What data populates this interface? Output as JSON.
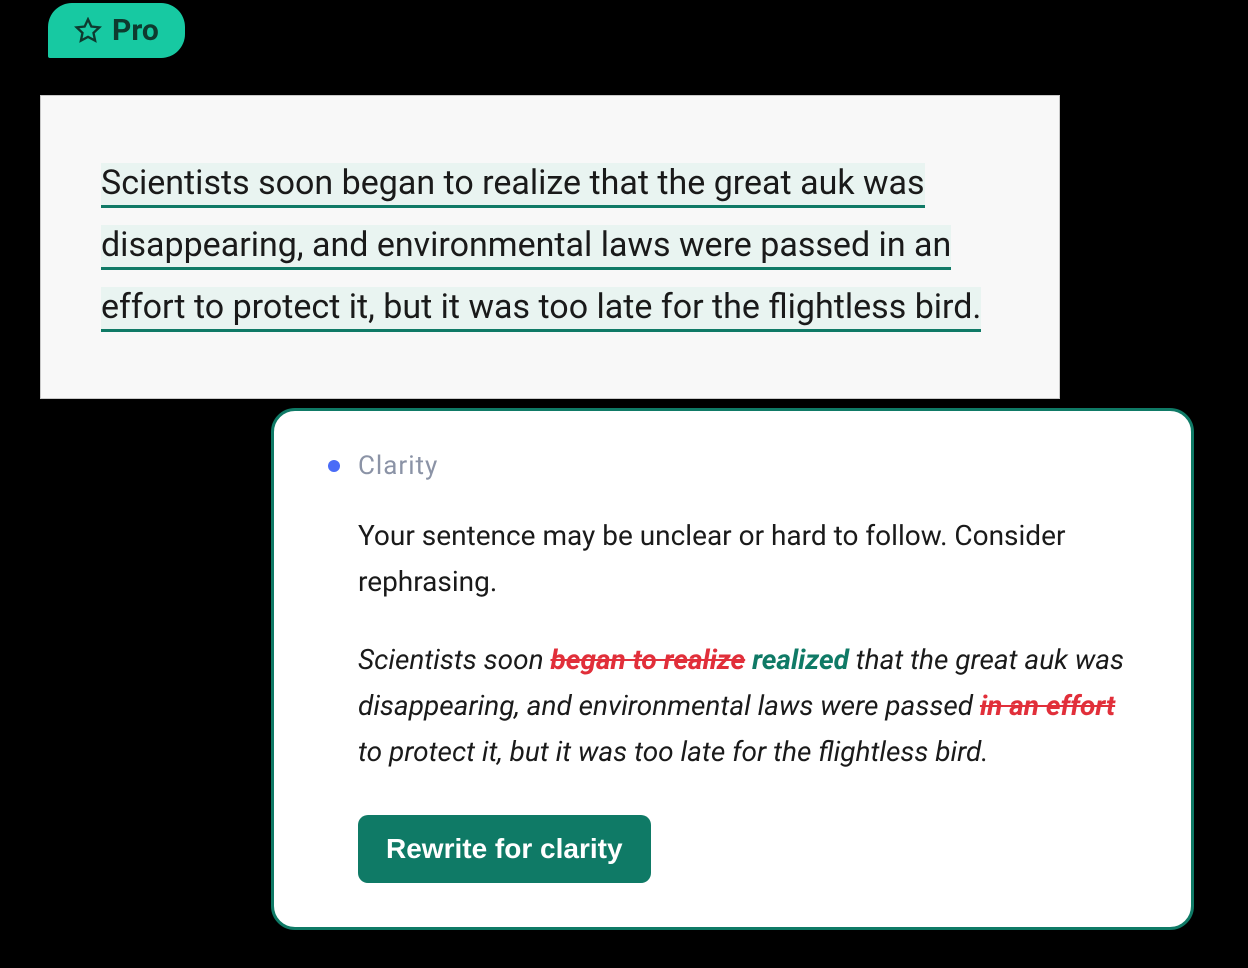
{
  "pro_badge": {
    "label": "Pro"
  },
  "editor": {
    "sentence": "Scientists soon began to realize that the great auk was disappearing, and environmental laws were passed in an effort to protect it, but it was too late for the flightless bird."
  },
  "suggestion": {
    "type_label": "Clarity",
    "description": "Your sentence may be unclear or hard to follow. Consider rephrasing.",
    "sample": {
      "pre1": "Scientists soon ",
      "strike1": "began to realize",
      "insert1": "realized",
      "mid1": " that the great auk was disappearing, and environmental laws were passed ",
      "strike2": "in an effort",
      "post": " to protect it, but it was too late for the flightless bird."
    },
    "button_label": "Rewrite for clarity"
  }
}
